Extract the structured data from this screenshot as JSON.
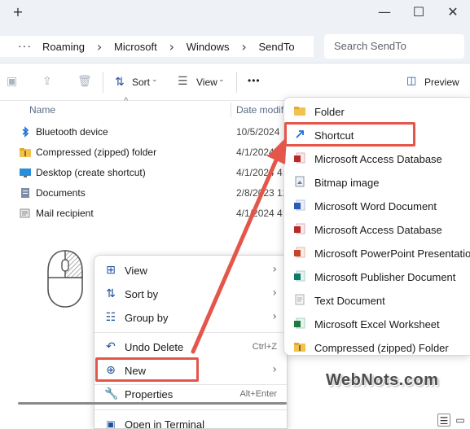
{
  "titlebar": {
    "new_tab": "+",
    "minimize": "—",
    "maximize": "☐",
    "close": "✕"
  },
  "address": {
    "more": "···",
    "crumbs": [
      "Roaming",
      "Microsoft",
      "Windows",
      "SendTo"
    ],
    "separator": "›",
    "search_placeholder": "Search SendTo"
  },
  "toolbar": {
    "sort_label": "Sort",
    "view_label": "View",
    "more": "•••",
    "preview_label": "Preview"
  },
  "columns": {
    "name": "Name",
    "date": "Date modifi"
  },
  "files": [
    {
      "name": "Bluetooth device",
      "date": "10/5/2024",
      "icon": "bluetooth-icon",
      "color": "#1f6fd6"
    },
    {
      "name": "Compressed (zipped) folder",
      "date": "4/1/2024 4:4",
      "icon": "zip-folder-icon",
      "color": "#e8b83a"
    },
    {
      "name": "Desktop (create shortcut)",
      "date": "4/1/2024 4:4",
      "icon": "desktop-icon",
      "color": "#2a8fd8"
    },
    {
      "name": "Documents",
      "date": "2/8/2023 12",
      "icon": "documents-icon",
      "color": "#7d8ea8"
    },
    {
      "name": "Mail recipient",
      "date": "4/1/2024 4:4",
      "icon": "mail-icon",
      "color": "#8f8f8f"
    }
  ],
  "context_menu": {
    "items": [
      {
        "label": "View",
        "icon": "grid-icon",
        "chevron": "›"
      },
      {
        "label": "Sort by",
        "icon": "sort-icon",
        "chevron": "›"
      },
      {
        "label": "Group by",
        "icon": "group-icon",
        "chevron": "›"
      },
      {
        "label": "Undo Delete",
        "icon": "undo-icon",
        "shortcut": "Ctrl+Z"
      },
      {
        "label": "New",
        "icon": "add-circle-icon",
        "chevron": "›"
      },
      {
        "label": "Properties",
        "icon": "wrench-icon",
        "shortcut": "Alt+Enter"
      },
      {
        "label": "Open in Terminal",
        "icon": "terminal-icon"
      }
    ]
  },
  "new_submenu": {
    "items": [
      {
        "label": "Folder",
        "icon": "folder-icon",
        "color": "#f2c14e"
      },
      {
        "label": "Shortcut",
        "icon": "shortcut-icon",
        "color": "#1f6fd6"
      },
      {
        "label": "Microsoft Access Database",
        "icon": "access-icon",
        "color": "#b52a2a"
      },
      {
        "label": "Bitmap image",
        "icon": "bitmap-icon",
        "color": "#6a7b93"
      },
      {
        "label": "Microsoft Word Document",
        "icon": "word-icon",
        "color": "#2b5cb8"
      },
      {
        "label": "Microsoft Access Database",
        "icon": "access-icon",
        "color": "#b52a2a"
      },
      {
        "label": "Microsoft PowerPoint Presentation",
        "icon": "powerpoint-icon",
        "color": "#c4452a"
      },
      {
        "label": "Microsoft Publisher Document",
        "icon": "publisher-icon",
        "color": "#0d7a6a"
      },
      {
        "label": "Text Document",
        "icon": "text-document-icon",
        "color": "#b0b0b0"
      },
      {
        "label": "Microsoft Excel Worksheet",
        "icon": "excel-icon",
        "color": "#1e7a42"
      },
      {
        "label": "Compressed (zipped) Folder",
        "icon": "zip-folder-icon",
        "color": "#e8b83a"
      }
    ]
  },
  "watermark": "WebNots.com",
  "highlight_color": "#e4564a"
}
